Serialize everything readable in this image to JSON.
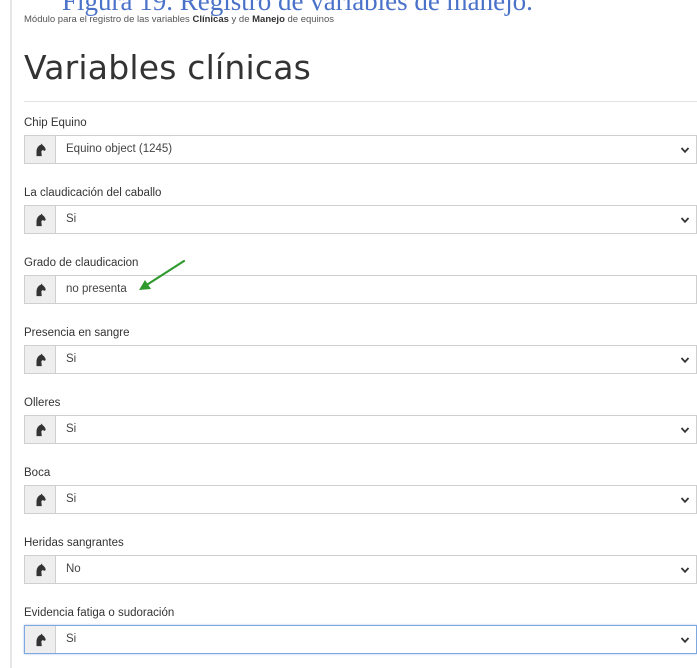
{
  "caption": "Figura 19. Registro de variables de manejo.",
  "subtitle": {
    "prefix": "Módulo para el registro de las variables ",
    "bold1": "Clínicas",
    "middle": " y de ",
    "bold2": "Manejo",
    "suffix": " de equinos"
  },
  "page_title": "Variables clínicas",
  "fields": [
    {
      "label": "Chip Equino",
      "value": "Equino object (1245)",
      "type": "select"
    },
    {
      "label": "La claudicación del caballo",
      "value": "Si",
      "type": "select"
    },
    {
      "label": "Grado de claudicacion",
      "value": "no presenta",
      "type": "text"
    },
    {
      "label": "Presencia en sangre",
      "value": "Si",
      "type": "select"
    },
    {
      "label": "Olleres",
      "value": "Si",
      "type": "select"
    },
    {
      "label": "Boca",
      "value": "Si",
      "type": "select"
    },
    {
      "label": "Heridas sangrantes",
      "value": "No",
      "type": "select"
    },
    {
      "label": "Evidencia fatiga o sudoración",
      "value": "Si",
      "type": "select"
    }
  ],
  "icons": {
    "addon": "horse-head-icon",
    "dropdown": "chevron-down-icon",
    "annotation": "green-arrow-icon"
  },
  "colors": {
    "annotation_arrow": "#2e9a2e",
    "caption": "#4a72c8",
    "focus_border": "#7fa8de"
  }
}
